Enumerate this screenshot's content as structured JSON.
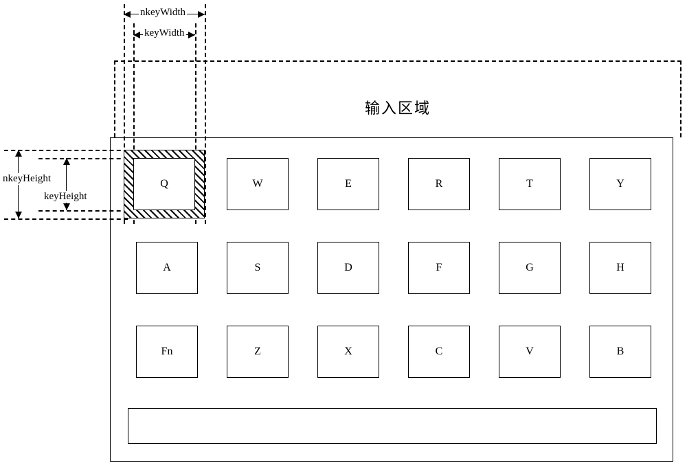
{
  "labels": {
    "input_area": "输入区域",
    "nkeyWidth": "nkeyWidth",
    "keyWidth": "keyWidth",
    "nkeyHeight": "nkeyHeight",
    "keyHeight": "keyHeight"
  },
  "keys": {
    "row1": [
      "Q",
      "W",
      "E",
      "R",
      "T",
      "Y"
    ],
    "row2": [
      "A",
      "S",
      "D",
      "F",
      "G",
      "H"
    ],
    "row3": [
      "Fn",
      "Z",
      "X",
      "C",
      "V",
      "B"
    ]
  },
  "layout_note": "Diagram of a virtual keyboard showing the difference between a key's drawn size (keyWidth/keyHeight) and its effective touch area (nkeyWidth/nkeyHeight), with an input area above the keyboard."
}
